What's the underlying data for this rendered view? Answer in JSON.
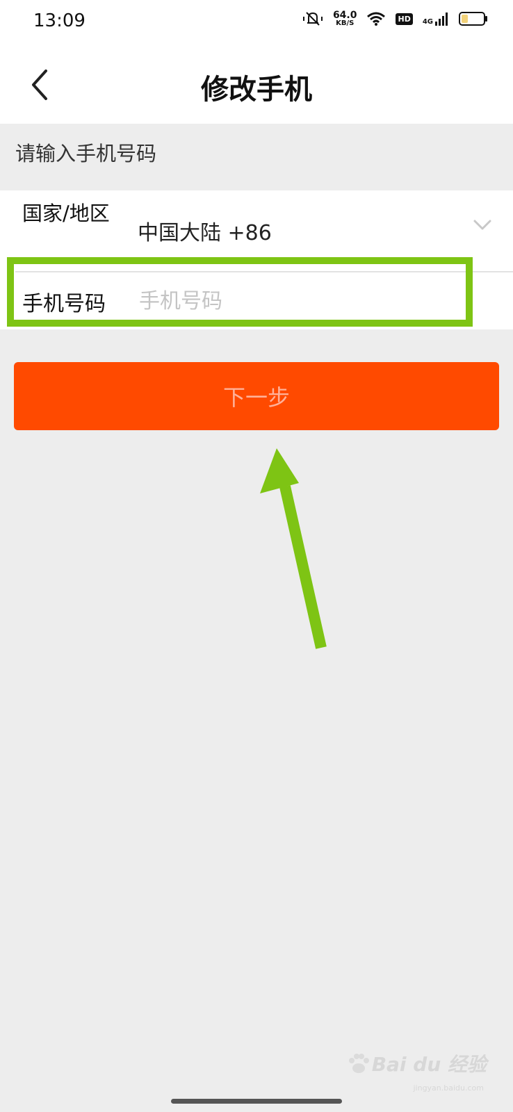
{
  "status_bar": {
    "time": "13:09",
    "speed_value": "64.0",
    "speed_unit": "KB/S",
    "hd_label": "HD",
    "network_label": "4G",
    "battery_level": 0.3
  },
  "header": {
    "title": "修改手机",
    "back_icon": "chevron-left-icon"
  },
  "form": {
    "hint": "请输入手机号码",
    "country_label": "国家/地区",
    "country_value": "中国大陆 +86",
    "phone_label": "手机号码",
    "phone_placeholder": "手机号码",
    "phone_value": ""
  },
  "actions": {
    "next_label": "下一步"
  },
  "watermark": {
    "text": "Bai du 经验",
    "sub": "jingyan.baidu.com"
  },
  "colors": {
    "accent": "#ff4a00",
    "annotation": "#7ec414",
    "background": "#ededed"
  }
}
